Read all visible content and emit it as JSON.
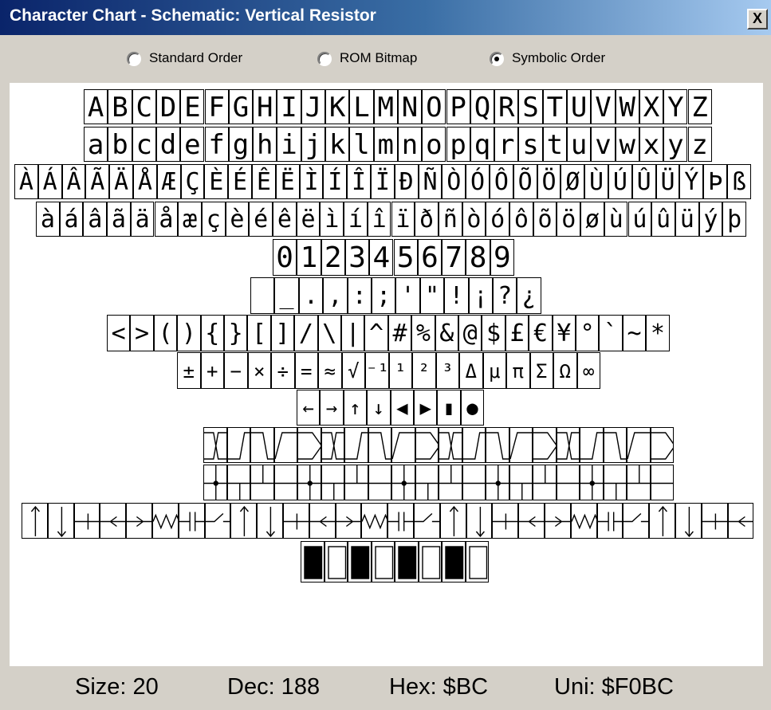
{
  "window": {
    "title": "Character Chart - Schematic: Vertical Resistor",
    "close_label": "X"
  },
  "radio_options": [
    {
      "label": "Standard Order",
      "accesskey": "S",
      "selected": false
    },
    {
      "label": "ROM Bitmap",
      "accesskey": "R",
      "selected": false
    },
    {
      "label": "Symbolic Order",
      "accesskey": "y",
      "selected": true
    }
  ],
  "chart_rows": [
    {
      "kind": "text",
      "chars": [
        "A",
        "B",
        "C",
        "D",
        "E",
        "F",
        "G",
        "H",
        "I",
        "J",
        "K",
        "L",
        "M",
        "N",
        "O",
        "P",
        "Q",
        "R",
        "S",
        "T",
        "U",
        "V",
        "W",
        "X",
        "Y",
        "Z"
      ]
    },
    {
      "kind": "text",
      "chars": [
        "a",
        "b",
        "c",
        "d",
        "e",
        "f",
        "g",
        "h",
        "i",
        "j",
        "k",
        "l",
        "m",
        "n",
        "o",
        "p",
        "q",
        "r",
        "s",
        "t",
        "u",
        "v",
        "w",
        "x",
        "y",
        "z"
      ]
    },
    {
      "kind": "text",
      "chars": [
        "À",
        "Á",
        "Â",
        "Ã",
        "Ä",
        "Å",
        "Æ",
        "Ç",
        "È",
        "É",
        "Ê",
        "Ë",
        "Ì",
        "Í",
        "Î",
        "Ï",
        "Đ",
        "Ñ",
        "Ò",
        "Ó",
        "Ô",
        "Õ",
        "Ö",
        "Ø",
        "Ù",
        "Ú",
        "Û",
        "Ü",
        "Ý",
        "Þ",
        "ß"
      ]
    },
    {
      "kind": "text",
      "chars": [
        "à",
        "á",
        "â",
        "ã",
        "ä",
        "å",
        "æ",
        "ç",
        "è",
        "é",
        "ê",
        "ë",
        "ì",
        "í",
        "î",
        "ï",
        "ð",
        "ñ",
        "ò",
        "ó",
        "ô",
        "õ",
        "ö",
        "ø",
        "ù",
        "ú",
        "û",
        "ü",
        "ý",
        "þ"
      ]
    },
    {
      "kind": "text",
      "chars": [
        "0",
        "1",
        "2",
        "3",
        "4",
        "5",
        "6",
        "7",
        "8",
        "9"
      ]
    },
    {
      "kind": "text",
      "chars": [
        " ",
        "_",
        ".",
        ",",
        ":",
        ";",
        "'",
        "\"",
        "!",
        "¡",
        "?",
        "¿"
      ]
    },
    {
      "kind": "text",
      "chars": [
        "<",
        ">",
        "(",
        ")",
        "{",
        "}",
        "[",
        "]",
        "/",
        "\\",
        "|",
        "^",
        "#",
        "%",
        "&",
        "@",
        "$",
        "£",
        "€",
        "¥",
        "°",
        "`",
        "~",
        "*"
      ]
    },
    {
      "kind": "text",
      "chars": [
        "±",
        "+",
        "−",
        "×",
        "÷",
        "=",
        "≈",
        "√",
        "⁻¹",
        "¹",
        "²",
        "³",
        "Δ",
        "μ",
        "π",
        "Σ",
        "Ω",
        "∞"
      ]
    },
    {
      "kind": "text",
      "chars": [
        "←",
        "→",
        "↑",
        "↓",
        "◀",
        "▶",
        "▮",
        "●"
      ]
    },
    {
      "kind": "symbol",
      "count": 20,
      "description": "timing waveform glyphs"
    },
    {
      "kind": "symbol",
      "count": 20,
      "description": "bus and wire junction glyphs"
    },
    {
      "kind": "symbol",
      "count": 28,
      "description": "schematic component glyphs"
    },
    {
      "kind": "symbol",
      "count": 8,
      "description": "block glyphs"
    }
  ],
  "status": {
    "size": "Size: 20",
    "dec": "Dec: 188",
    "hex": "Hex: $BC",
    "uni": "Uni: $F0BC"
  },
  "colors": {
    "titlebar_start": "#0a246a",
    "titlebar_end": "#a6caf0",
    "chrome": "#d4d0c8",
    "chart_bg": "#ffffff",
    "glyph": "#000000"
  }
}
